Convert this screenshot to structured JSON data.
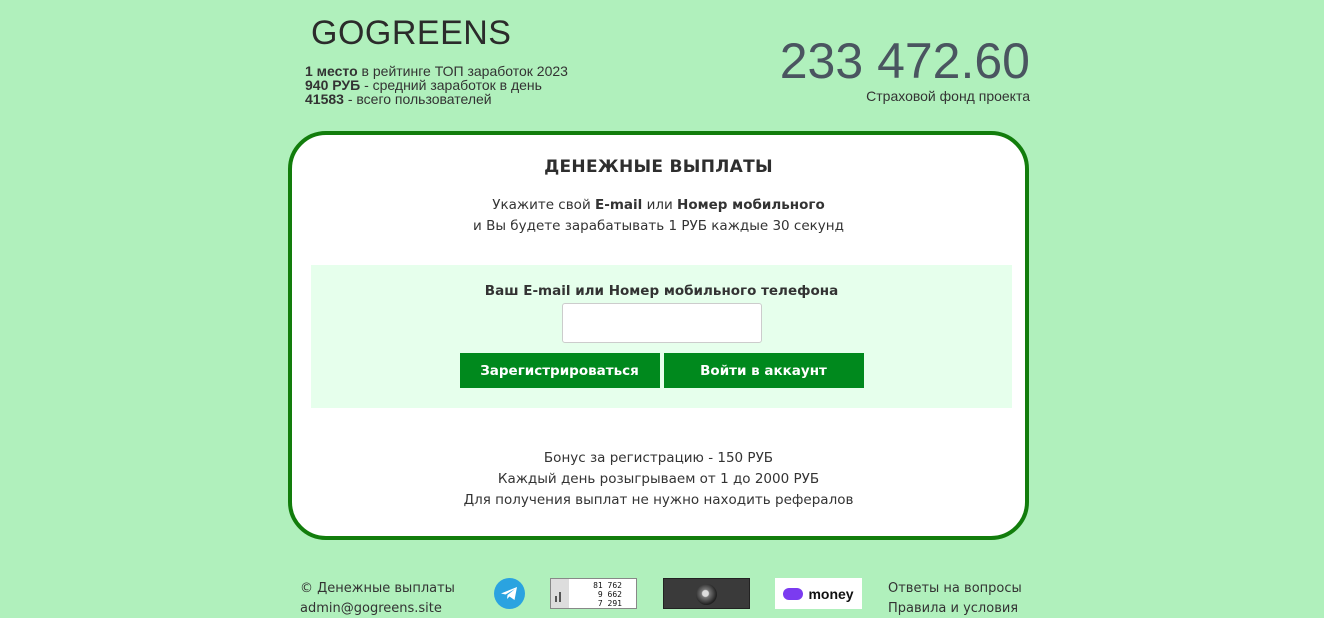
{
  "header": {
    "brand": "GOGREENS",
    "stats": [
      {
        "bold": "1 место",
        "text": " в рейтинге ТОП заработок 2023"
      },
      {
        "bold": "940 РУБ",
        "text": " - средний заработок в день"
      },
      {
        "bold": "41583",
        "text": " - всего пользователей"
      }
    ],
    "fund_amount": "233 472.60",
    "fund_label": "Страховой фонд проекта"
  },
  "card": {
    "title": "ДЕНЕЖНЫЕ ВЫПЛАТЫ",
    "sub_pre": "Укажите свой ",
    "sub_email": "E-mail",
    "sub_or": " или ",
    "sub_phone": "Номер мобильного",
    "sub_line2": "и Вы будете зарабатывать 1 РУБ каждые 30 секунд",
    "form_label": "Ваш E-mail или Номер мобильного телефона",
    "input_value": "",
    "register_label": "Зарегистрироваться",
    "login_label": "Войти в аккаунт",
    "bonus_lines": [
      "Бонус за регистрацию - 150 РУБ",
      "Каждый день розыгрываем от 1 до 2000 РУБ",
      "Для получения выплат не нужно находить рефералов"
    ]
  },
  "footer": {
    "copyright": "© Денежные выплаты",
    "email": "admin@gogreens.site",
    "counter": [
      "81 762",
      "9 662",
      "7 291"
    ],
    "money_label": "money",
    "faq": "Ответы на вопросы",
    "rules": "Правила и условия"
  },
  "colors": {
    "background": "#b0f0bc",
    "card_border": "#127d0c",
    "button": "#00891d",
    "form_box": "#e6ffec"
  },
  "icons": {
    "telegram": "telegram-icon",
    "counter": "visitor-counter-icon",
    "badge": "dark-orb-badge-icon",
    "money": "yoomoney-logo-icon"
  }
}
